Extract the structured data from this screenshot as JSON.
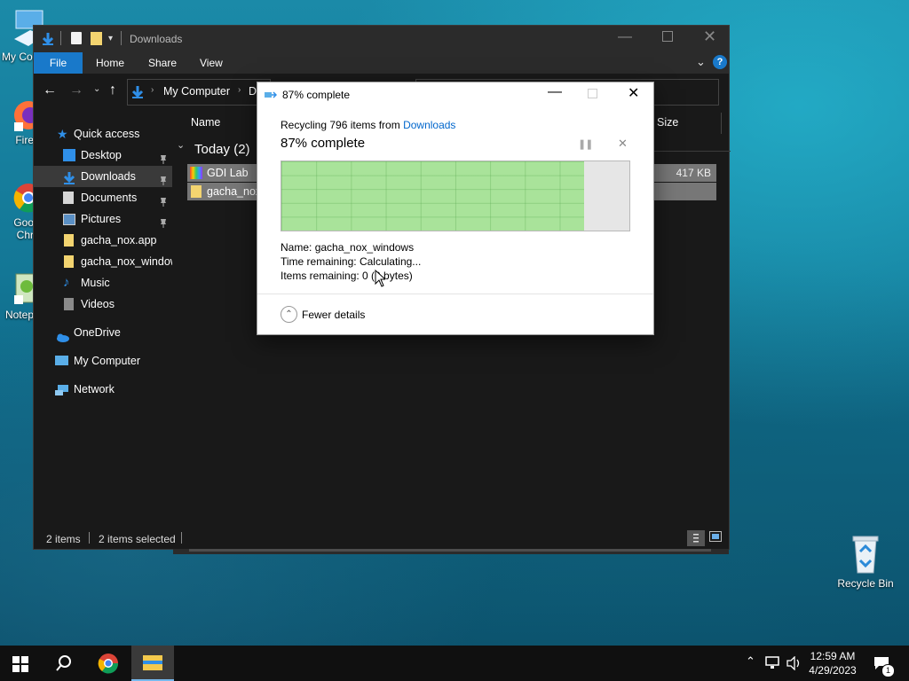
{
  "desktop": {
    "icons": [
      {
        "label": "My Co",
        "icon": "computer-icon"
      },
      {
        "label": "Fire",
        "icon": "firefox-icon"
      },
      {
        "label": "Goo",
        "label2": "Chr",
        "icon": "chrome-icon"
      },
      {
        "label": "Notep",
        "icon": "notepad-icon"
      },
      {
        "label": "Recycle Bin",
        "icon": "recycle-bin-icon"
      }
    ]
  },
  "explorer": {
    "title": "Downloads",
    "ribbon_tabs": [
      "File",
      "Home",
      "Share",
      "View"
    ],
    "address": [
      "My Computer",
      "D"
    ],
    "nav": {
      "quick_access": "Quick access",
      "items": [
        {
          "label": "Desktop",
          "pinned": true
        },
        {
          "label": "Downloads",
          "pinned": true
        },
        {
          "label": "Documents",
          "pinned": true
        },
        {
          "label": "Pictures",
          "pinned": true
        },
        {
          "label": "gacha_nox.app",
          "pinned": false
        },
        {
          "label": "gacha_nox_windows",
          "pinned": false
        },
        {
          "label": "Music",
          "pinned": false
        },
        {
          "label": "Videos",
          "pinned": false
        }
      ],
      "onedrive": "OneDrive",
      "my_computer": "My Computer",
      "network": "Network"
    },
    "columns": {
      "name": "Name",
      "size": "Size"
    },
    "group": "Today (2)",
    "files": [
      {
        "name": "GDI Lab",
        "size": "417 KB",
        "icon": "app-icon"
      },
      {
        "name": "gacha_nox",
        "size": "",
        "icon": "folder-icon"
      }
    ],
    "status": {
      "items": "2 items",
      "selected": "2 items selected"
    }
  },
  "dialog": {
    "title": "87% complete",
    "recycling_prefix": "Recycling 796 items from",
    "recycling_link": "Downloads",
    "progress_text": "87% complete",
    "progress": 0.87,
    "name_label": "Name:",
    "name_value": "gacha_nox_windows",
    "time_label": "Time remaining:",
    "time_value": "Calculating...",
    "items_label": "Items remaining:",
    "items_value": "0 (0 bytes)",
    "fewer_details": "Fewer details"
  },
  "taskbar": {
    "time": "12:59 AM",
    "date": "4/29/2023",
    "notification_count": "1"
  },
  "colors": {
    "accent": "#0078d7",
    "progress_fill": "#a9e39a",
    "explorer_bg": "#191919",
    "link": "#0066cc"
  }
}
